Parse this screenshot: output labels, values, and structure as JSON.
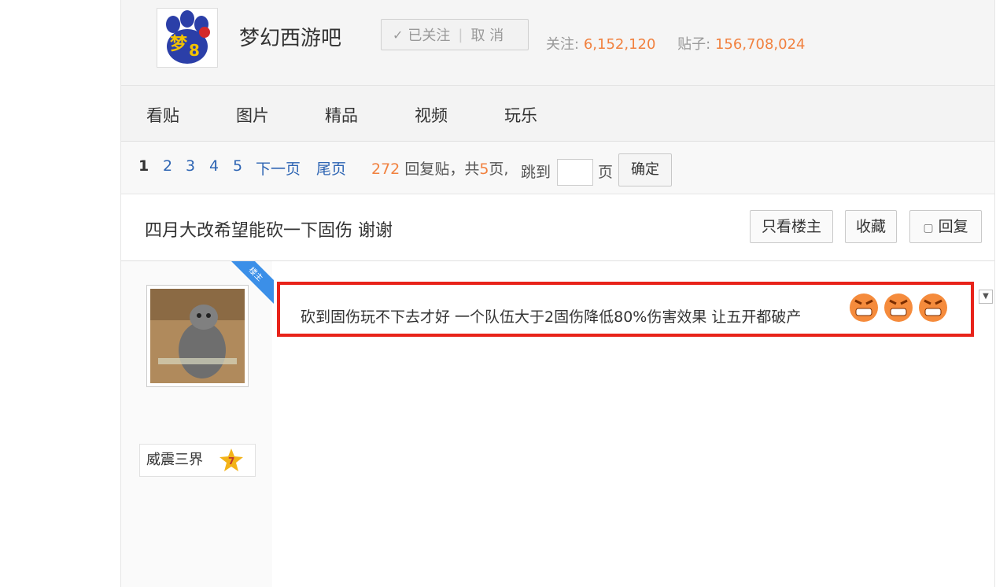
{
  "forum": {
    "name": "梦幻西游吧",
    "follow": {
      "status_label": "已关注",
      "cancel_label": "取 消"
    },
    "stats": {
      "follow_label": "关注:",
      "follow_count": "6,152,120",
      "posts_label": "贴子:",
      "posts_count": "156,708,024"
    }
  },
  "nav": {
    "tabs": [
      "看贴",
      "图片",
      "精品",
      "视频",
      "玩乐"
    ]
  },
  "pager": {
    "pages": [
      "1",
      "2",
      "3",
      "4",
      "5"
    ],
    "next_label": "下一页",
    "last_label": "尾页",
    "reply_count": "272",
    "reply_text": "回复贴，共",
    "total_pages": "5",
    "pages_suffix": "页,",
    "jump_label": "跳到",
    "page_suffix": "页",
    "ok_label": "确定"
  },
  "thread": {
    "title": "四月大改希望能砍一下固伤 谢谢",
    "buttons": {
      "only_op": "只看楼主",
      "favorite": "收藏",
      "reply": "回复"
    }
  },
  "post": {
    "badge": "楼主",
    "author": "威震三界",
    "level": "7",
    "content": "砍到固伤玩不下去才好 一个队伍大于2固伤降低80%伤害效果 让五开都破产",
    "emoticons": [
      "angry-face-icon",
      "angry-face-icon",
      "angry-face-icon"
    ]
  },
  "colors": {
    "accent_orange": "#f1813f",
    "link_blue": "#2d64b3",
    "highlight_red": "#e8231a",
    "badge_blue": "#3b8fe8"
  }
}
